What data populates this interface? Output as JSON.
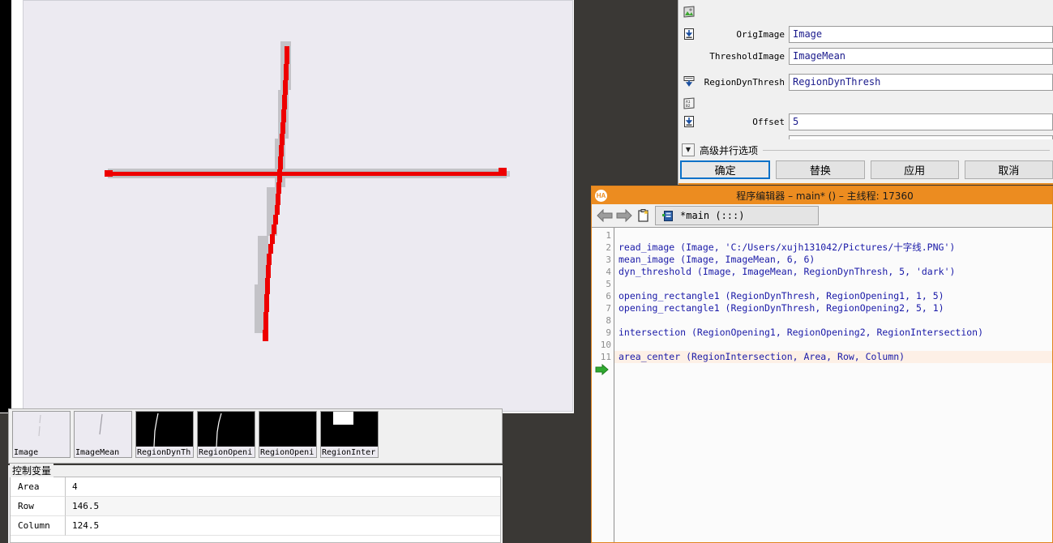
{
  "graphics_window": {
    "name": "graphics-canvas",
    "background_color": "#eceaf1",
    "line_color": "#ee0000",
    "shadow_color": "#b4b4b4",
    "description": "cross-hair lines image"
  },
  "thumbnails": [
    {
      "label": "Image",
      "kind": "light"
    },
    {
      "label": "ImageMean",
      "kind": "light"
    },
    {
      "label": "RegionDynTh",
      "kind": "dark"
    },
    {
      "label": "RegionOpeni",
      "kind": "dark"
    },
    {
      "label": "RegionOpeni",
      "kind": "dark"
    },
    {
      "label": "RegionInter",
      "kind": "dark"
    }
  ],
  "control_variables": {
    "legend": "控制变量",
    "rows": [
      {
        "name": "Area",
        "value": "4"
      },
      {
        "name": "Row",
        "value": "146.5"
      },
      {
        "name": "Column",
        "value": "124.5"
      }
    ]
  },
  "operator_dialog": {
    "params": [
      {
        "icon": "image-icon",
        "label": "",
        "value": "",
        "has_input": false
      },
      {
        "icon": "input-image-icon",
        "label": "OrigImage",
        "value": "Image",
        "has_input": true
      },
      {
        "icon": "",
        "label": "ThresholdImage",
        "value": "ImageMean",
        "has_input": true
      },
      {
        "icon": "output-region-icon",
        "label": "RegionDynThresh",
        "value": "RegionDynThresh",
        "has_input": true
      },
      {
        "icon": "params-icon",
        "label": "",
        "value": "",
        "has_input": false
      },
      {
        "icon": "input-param-icon",
        "label": "Offset",
        "value": "5",
        "has_input": true
      },
      {
        "icon": "",
        "label": "",
        "value": "",
        "has_input": true
      }
    ],
    "advanced_label": "高级并行选项",
    "advanced_toggle_icon": "chevron-down-icon",
    "buttons": [
      {
        "label": "确定",
        "primary": true
      },
      {
        "label": "替换",
        "primary": false
      },
      {
        "label": "应用",
        "primary": false
      },
      {
        "label": "取消",
        "primary": false
      }
    ]
  },
  "program_editor": {
    "badge": "HA",
    "title": "程序编辑器 – main* () – 主线程: 17360",
    "toolbar": {
      "back_icon": "arrow-left-icon",
      "forward_icon": "arrow-right-icon",
      "clipboard_icon": "clipboard-new-icon",
      "tab_icon": "procedure-icon",
      "tab_label": "*main (:::)"
    },
    "line_numbers": [
      "1",
      "2",
      "3",
      "4",
      "5",
      "6",
      "7",
      "8",
      "9",
      "10",
      "11"
    ],
    "code_lines": [
      "",
      "read_image (Image, 'C:/Users/xujh131042/Pictures/十字线.PNG')",
      "mean_image (Image, ImageMean, 6, 6)",
      "dyn_threshold (Image, ImageMean, RegionDynThresh, 5, 'dark')",
      "",
      "opening_rectangle1 (RegionDynThresh, RegionOpening1, 1, 5)",
      "opening_rectangle1 (RegionDynThresh, RegionOpening2, 5, 1)",
      "",
      "intersection (RegionOpening1, RegionOpening2, RegionIntersection)",
      "",
      "area_center (RegionIntersection, Area, Row, Column)"
    ],
    "current_line_index": 10,
    "run_pointer_icon": "green-arrow-icon",
    "accent_color": "#ec8c20",
    "code_color": "#1a1aa8"
  }
}
